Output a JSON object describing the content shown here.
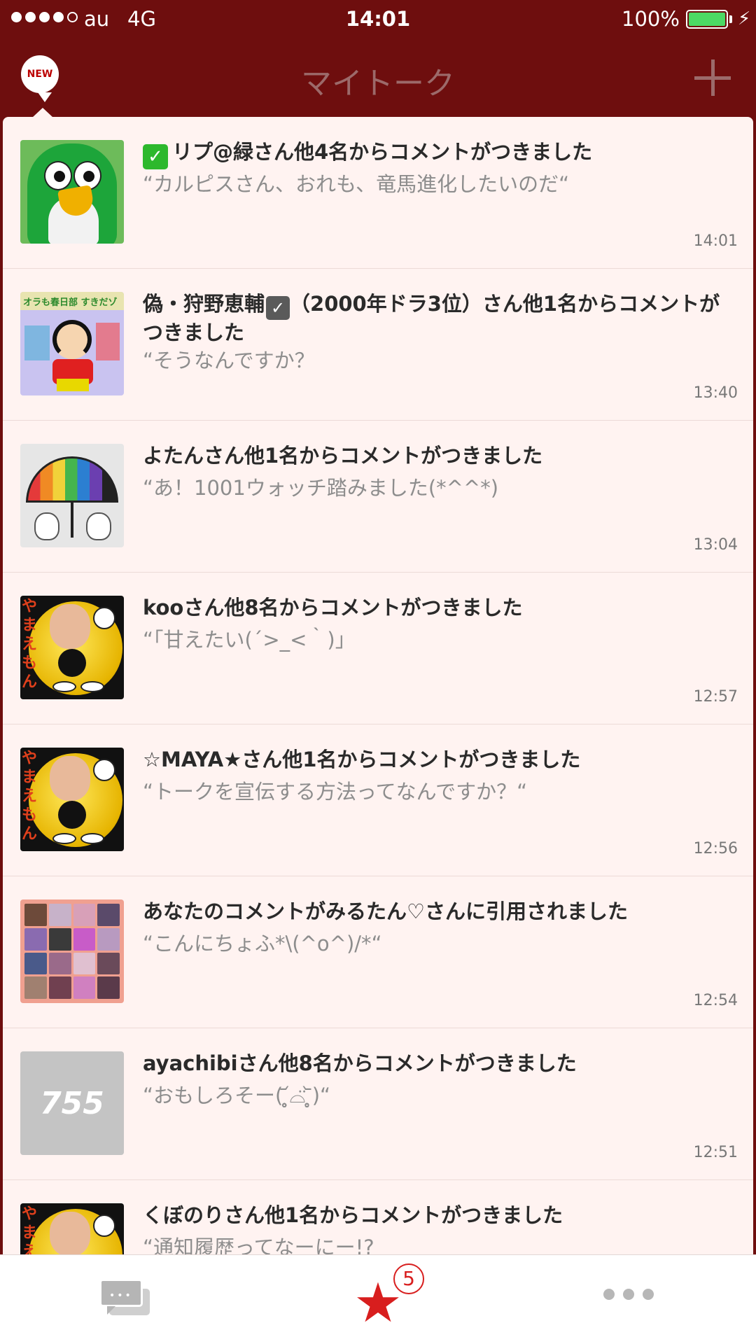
{
  "status_bar": {
    "carrier": "au",
    "network": "4G",
    "time": "14:01",
    "battery": "100%",
    "battery_level": 1.0,
    "signal_bars_filled": 4
  },
  "nav": {
    "new_badge": "NEW",
    "title": "マイトーク",
    "add_icon": "plus-icon"
  },
  "notifications": [
    {
      "title": "リプ@緑さん他4名からコメントがつきました",
      "quote": "“カルピスさん、おれも、竜馬進化したいのだ“",
      "time": "14:01",
      "avatar": "green-penguin",
      "title_prefix_icon": "green-check-icon"
    },
    {
      "title_a": "偽・狩野恵輔",
      "title_b": "（2000年ドラ3位）さん他1名からコメントがつきました",
      "quote": "“そうなんですか？",
      "time": "13:40",
      "avatar": "cartoon-boy",
      "title_inline_icon": "gray-check-icon"
    },
    {
      "title": "よたんさん他1名からコメントがつきました",
      "quote": "“あ！1001ウォッチ踏みました(*^^*)",
      "time": "13:04",
      "avatar": "rainbow-umbrella"
    },
    {
      "title": "kooさん他8名からコメントがつきました",
      "quote": "“「甘えたい(´>_<｀)」",
      "time": "12:57",
      "avatar": "yamaemon"
    },
    {
      "title": "☆MAYA★さん他1名からコメントがつきました",
      "quote": "“トークを宣伝する方法ってなんですか？“",
      "time": "12:56",
      "avatar": "yamaemon"
    },
    {
      "title": "あなたのコメントがみるたん♡さんに引用されました",
      "quote": "“こんにちょふ*\\(^o^)/*“",
      "time": "12:54",
      "avatar": "photo-grid"
    },
    {
      "title": "ayachibiさん他8名からコメントがつきました",
      "quote": "“おもしろそー( ̥̥̥̥̥̥̥̥᷄⌓̈ ̥̥̥̥̥̥̥̥᷅)“",
      "time": "12:51",
      "avatar": "755-logo",
      "avatar_text": "755"
    },
    {
      "title": "くぼのりさん他1名からコメントがつきました",
      "quote": "“通知履歴ってなーにー!?",
      "time": "",
      "avatar": "yamaemon"
    }
  ],
  "yamaemon_text": "やまえもん",
  "shin_band_text": "オラも春日部 すきだゾ",
  "tab_bar": {
    "talk_icon": "chat-bubbles-icon",
    "star_icon": "star-icon",
    "star_badge": "5",
    "more_icon": "more-dots-icon",
    "accent": "#d81e1e"
  },
  "colors": {
    "header_bg": "#6e0e0e",
    "list_bg": "#fff3f1",
    "title_text": "#2a2a2a",
    "quote_text": "#8d8d8d"
  }
}
